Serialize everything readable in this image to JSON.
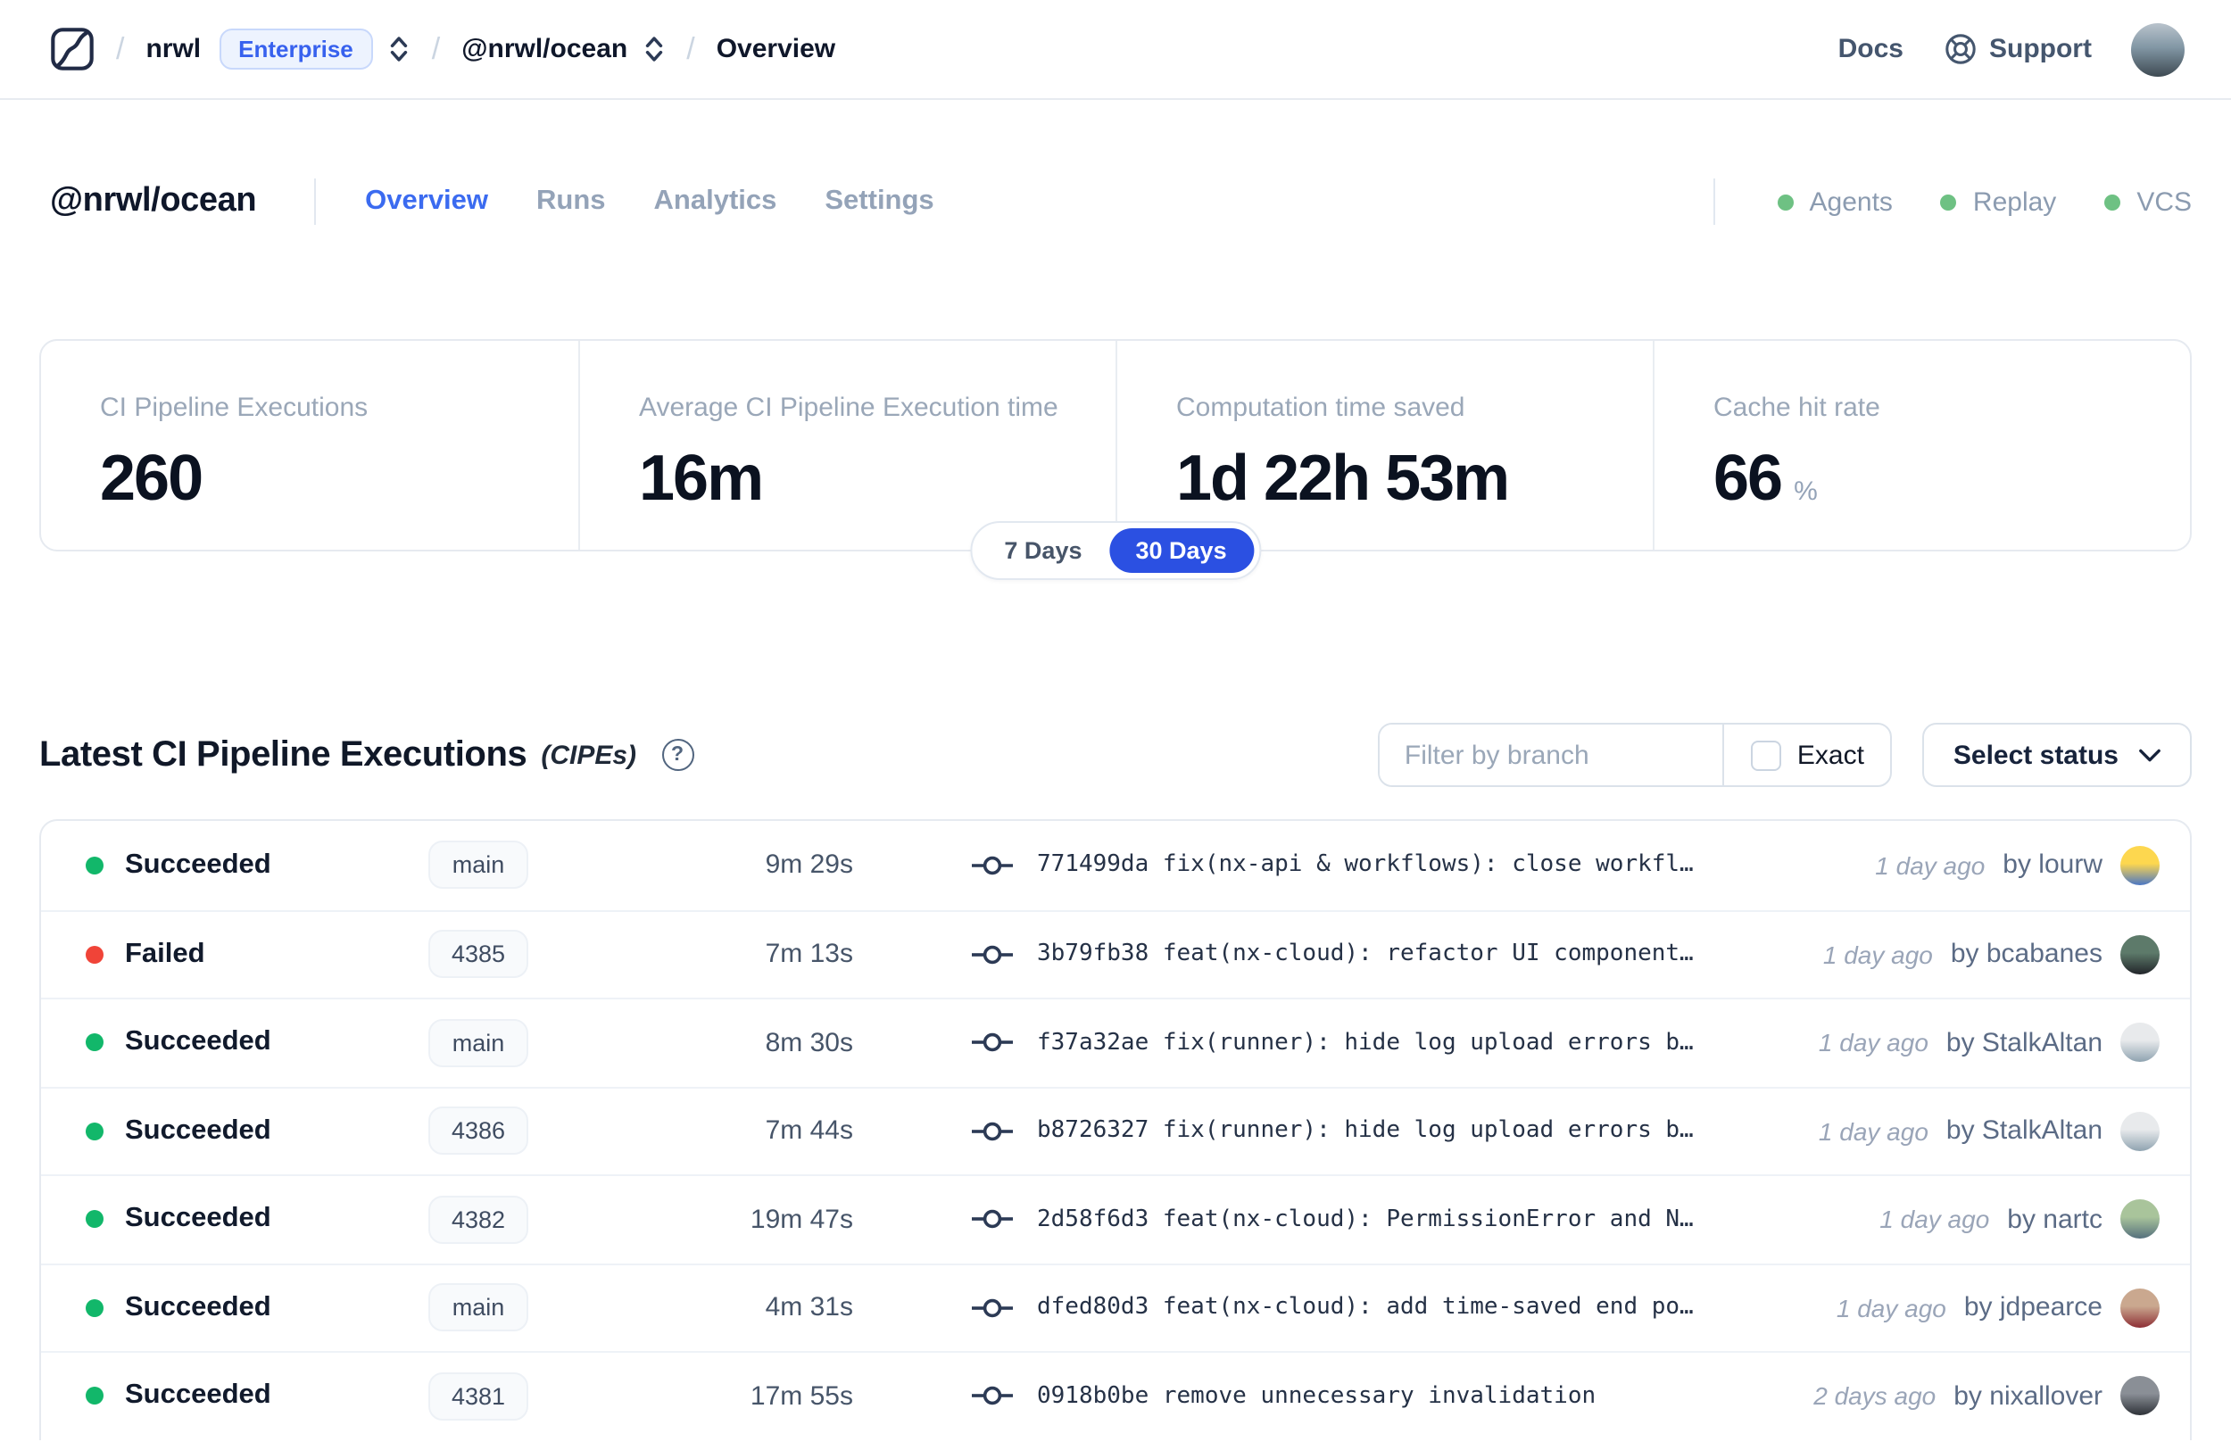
{
  "topbar": {
    "breadcrumb": {
      "separator": "/",
      "org": "nrwl",
      "org_badge": "Enterprise",
      "workspace": "@nrwl/ocean",
      "page": "Overview"
    },
    "docs_label": "Docs",
    "support_label": "Support"
  },
  "workspace_header": {
    "title": "@nrwl/ocean",
    "tabs": [
      {
        "label": "Overview",
        "active": true
      },
      {
        "label": "Runs",
        "active": false
      },
      {
        "label": "Analytics",
        "active": false
      },
      {
        "label": "Settings",
        "active": false
      }
    ],
    "services": [
      {
        "label": "Agents",
        "status_color": "#6ec183"
      },
      {
        "label": "Replay",
        "status_color": "#6ec183"
      },
      {
        "label": "VCS",
        "status_color": "#6ec183"
      }
    ]
  },
  "stats": {
    "cards": [
      {
        "label": "CI Pipeline Executions",
        "value": "260",
        "suffix": ""
      },
      {
        "label": "Average CI Pipeline Execution time",
        "value": "16m",
        "suffix": ""
      },
      {
        "label": "Computation time saved",
        "value": "1d 22h 53m",
        "suffix": ""
      },
      {
        "label": "Cache hit rate",
        "value": "66",
        "suffix": "%"
      }
    ],
    "range_toggle": {
      "options": [
        {
          "label": "7 Days",
          "active": false
        },
        {
          "label": "30 Days",
          "active": true
        }
      ],
      "active_color": "#2b50e2"
    }
  },
  "cipe_section": {
    "title": "Latest CI Pipeline Executions",
    "title_suffix": "(CIPEs)",
    "help_glyph": "?",
    "filter_placeholder": "Filter by branch",
    "exact_label": "Exact",
    "status_select_label": "Select status",
    "status_colors": {
      "green": "#12b76a",
      "red": "#f04438"
    },
    "rows": [
      {
        "status": "Succeeded",
        "status_color": "green",
        "branch": "main",
        "duration": "9m 29s",
        "commit": "771499da fix(nx-api & workflows): close workfl…",
        "time": "1 day ago",
        "author": "by lourw",
        "avatar_colors": [
          "#fdd74f",
          "#4a76c4"
        ]
      },
      {
        "status": "Failed",
        "status_color": "red",
        "branch": "4385",
        "duration": "7m 13s",
        "commit": "3b79fb38 feat(nx-cloud): refactor UI component…",
        "time": "1 day ago",
        "author": "by bcabanes",
        "avatar_colors": [
          "#5d7a6a",
          "#22252a"
        ]
      },
      {
        "status": "Succeeded",
        "status_color": "green",
        "branch": "main",
        "duration": "8m 30s",
        "commit": "f37a32ae fix(runner): hide log upload errors b…",
        "time": "1 day ago",
        "author": "by StalkAltan",
        "avatar_colors": [
          "#e8eaec",
          "#8fa3b0"
        ]
      },
      {
        "status": "Succeeded",
        "status_color": "green",
        "branch": "4386",
        "duration": "7m 44s",
        "commit": "b8726327 fix(runner): hide log upload errors b…",
        "time": "1 day ago",
        "author": "by StalkAltan",
        "avatar_colors": [
          "#e8eaec",
          "#8fa3b0"
        ]
      },
      {
        "status": "Succeeded",
        "status_color": "green",
        "branch": "4382",
        "duration": "19m 47s",
        "commit": "2d58f6d3 feat(nx-cloud): PermissionError and N…",
        "time": "1 day ago",
        "author": "by nartc",
        "avatar_colors": [
          "#a9c49b",
          "#55707d"
        ]
      },
      {
        "status": "Succeeded",
        "status_color": "green",
        "branch": "main",
        "duration": "4m 31s",
        "commit": "dfed80d3 feat(nx-cloud): add time-saved end po…",
        "time": "1 day ago",
        "author": "by jdpearce",
        "avatar_colors": [
          "#caa88f",
          "#8d2f35"
        ]
      },
      {
        "status": "Succeeded",
        "status_color": "green",
        "branch": "4381",
        "duration": "17m 55s",
        "commit": "0918b0be remove unnecessary invalidation",
        "time": "2 days ago",
        "author": "by nixallover",
        "avatar_colors": [
          "#8a8f96",
          "#2e3238"
        ]
      }
    ]
  }
}
